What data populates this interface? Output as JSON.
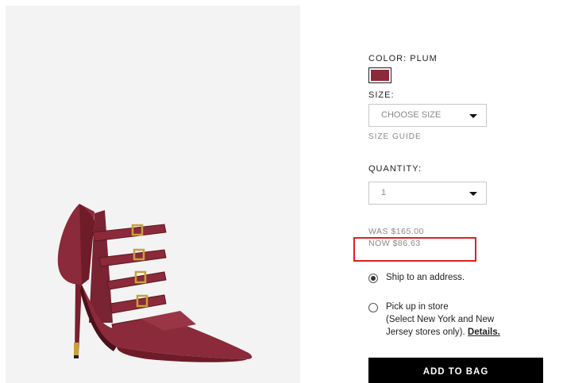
{
  "product": {
    "color_label": "COLOR: PLUM",
    "swatch_color": "#8b2a3a",
    "size_label": "SIZE:",
    "size_placeholder": "CHOOSE SIZE",
    "size_guide": "SIZE GUIDE",
    "quantity_label": "QUANTITY:",
    "quantity_value": "1",
    "was_price": "WAS $165.00",
    "now_price": "NOW $86.63",
    "highlight_color": "#e02020"
  },
  "shipping": {
    "options": [
      {
        "label": "Ship to an address.",
        "selected": true
      },
      {
        "label_line1": "Pick up in store",
        "label_line2": "(Select New York and New",
        "label_line3": "Jersey stores only).",
        "link": "Details.",
        "selected": false
      }
    ]
  },
  "cta": {
    "add_to_bag": "ADD TO BAG"
  }
}
